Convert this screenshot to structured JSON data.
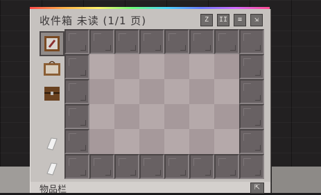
{
  "window": {
    "title": "收件箱 未读 (1/1 页)",
    "footer_label": "物品栏"
  },
  "toolbar": {
    "buttons": [
      {
        "label": "Z",
        "icon": "sort-icon"
      },
      {
        "label": "II",
        "icon": "columns-icon"
      },
      {
        "label": "≡",
        "icon": "list-icon"
      },
      {
        "label": "⇲",
        "icon": "collapse-icon"
      }
    ],
    "footer_button": {
      "label": "⇱",
      "icon": "expand-icon"
    }
  },
  "sidebar": {
    "items": [
      {
        "icon": "painting-icon"
      },
      {
        "icon": "item-frame-icon"
      },
      {
        "icon": "chest-icon"
      },
      {
        "icon": "empty-slot"
      },
      {
        "icon": "paper-icon"
      },
      {
        "icon": "paper-icon"
      }
    ]
  },
  "colors": {
    "slot": "#686163",
    "checker_light": "#b5a9aa",
    "checker_dark": "#a6999b",
    "panel": "#c6c2bf"
  }
}
